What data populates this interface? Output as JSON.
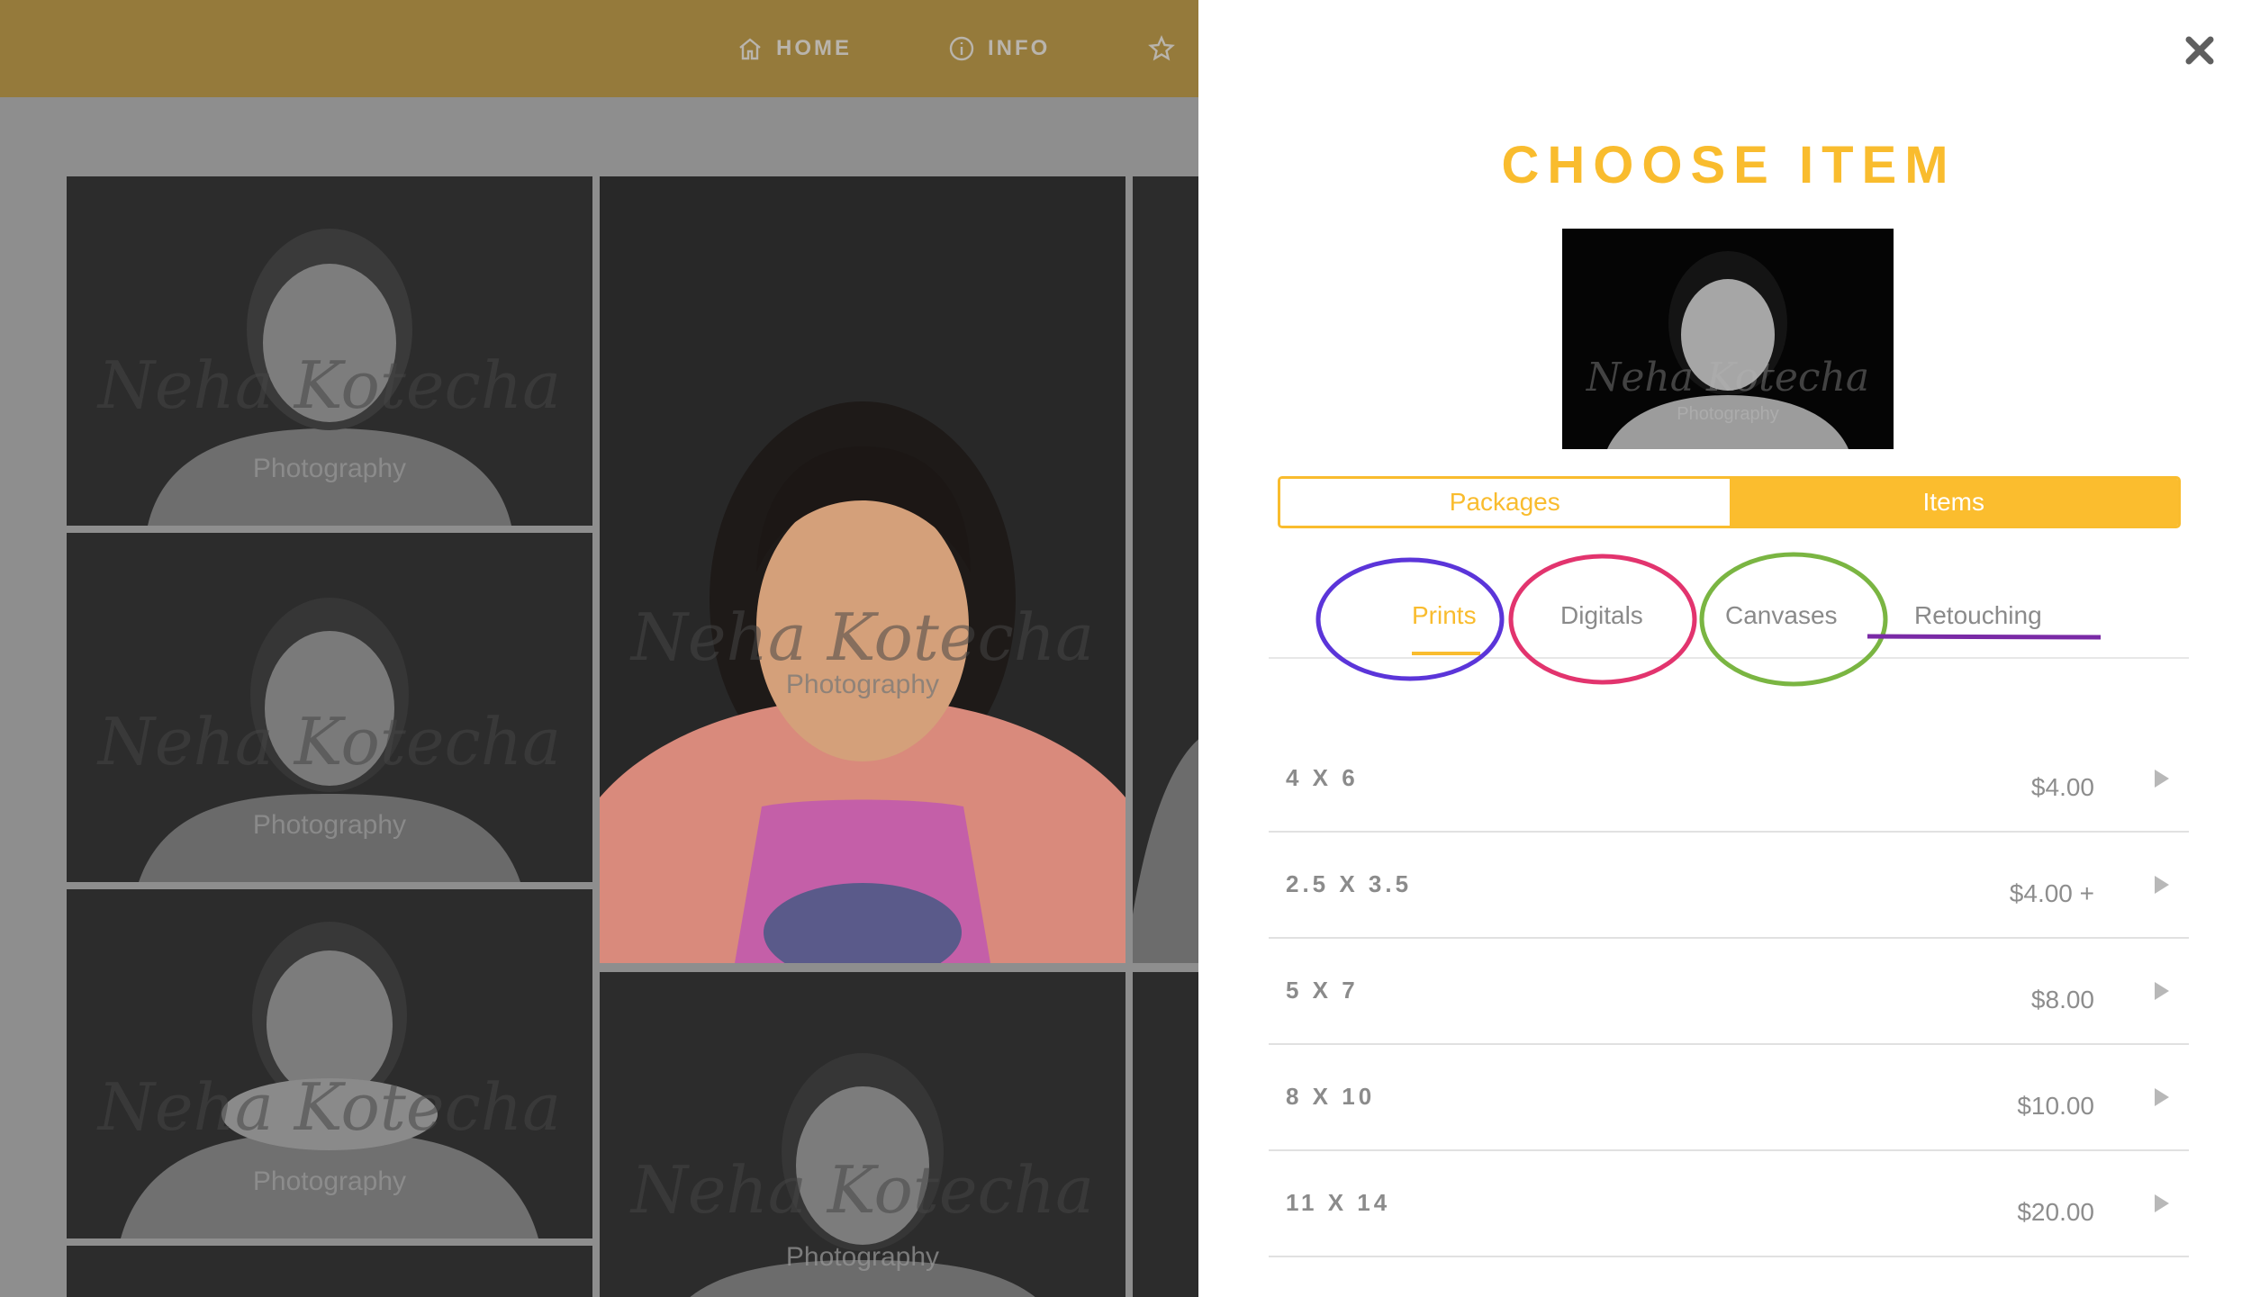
{
  "nav": {
    "home": "HOME",
    "info": "INFO",
    "home_icon": "home-icon",
    "info_icon": "info-icon",
    "favorites_icon": "star-icon"
  },
  "gallery": {
    "watermark_script": "Neha Kotecha",
    "watermark_text": "Photography"
  },
  "panel": {
    "title": "CHOOSE ITEM",
    "close_icon": "close-icon",
    "segments": {
      "packages": "Packages",
      "items": "Items",
      "active": "Items"
    },
    "subtabs": [
      "Prints",
      "Digitals",
      "Canvases",
      "Retouching"
    ],
    "active_subtab": "Prints",
    "rows": [
      {
        "size": "4 X 6",
        "price": "$4.00"
      },
      {
        "size": "2.5 X 3.5",
        "price": "$4.00 +"
      },
      {
        "size": "5 X 7",
        "price": "$8.00"
      },
      {
        "size": "8 X 10",
        "price": "$10.00"
      },
      {
        "size": "11 X 14",
        "price": "$20.00"
      }
    ]
  },
  "colors": {
    "accent": "#f9bc2e",
    "header_dimmed": "#957a3b",
    "annotation_prints": "#5b35d9",
    "annotation_digitals": "#e2346e",
    "annotation_canvases": "#7ab542",
    "annotation_retouching": "#7a2aa6"
  }
}
